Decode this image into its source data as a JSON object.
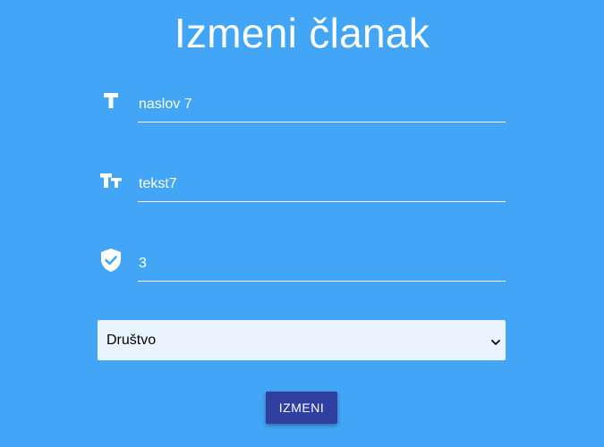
{
  "page": {
    "title": "Izmeni članak",
    "background_color": "#42a5f5"
  },
  "form": {
    "fields": [
      {
        "icon": "title-icon",
        "value": "naslov 7"
      },
      {
        "icon": "text-size-icon",
        "value": "tekst7"
      },
      {
        "icon": "verified-shield-icon",
        "value": "3"
      }
    ],
    "category_select": {
      "selected": "Društvo"
    },
    "submit_label": "IZMENI",
    "submit_color": "#303f9f"
  }
}
